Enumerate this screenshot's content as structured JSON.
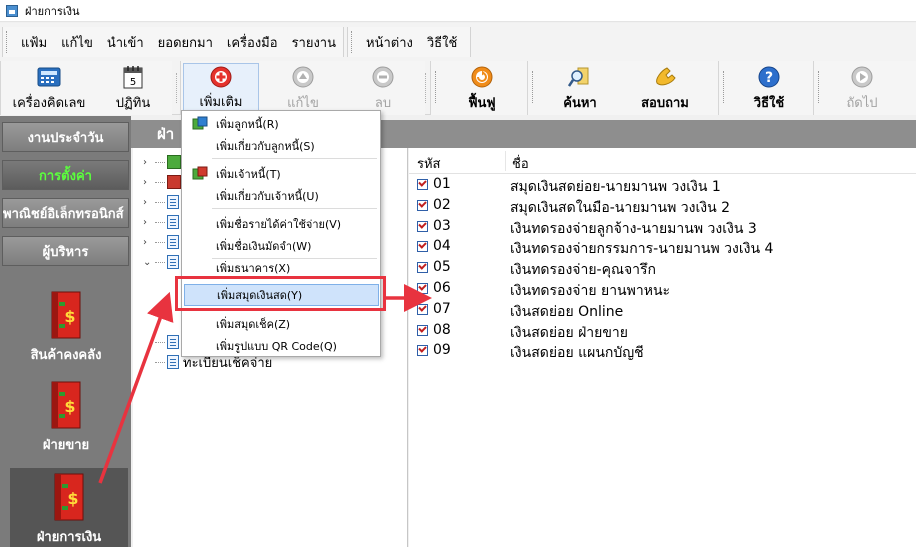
{
  "window": {
    "title": "ฝ่ายการเงิน"
  },
  "menubar": {
    "group1": [
      "แฟ้ม",
      "แก้ไข",
      "นำเข้า",
      "ยอดยกมา",
      "เครื่องมือ",
      "รายงาน"
    ],
    "group2": [
      "หน้าต่าง",
      "วิธีใช้"
    ]
  },
  "toolbar": {
    "calculator": "เครื่องคิดเลข",
    "calendar": "ปฏิทิน",
    "calendar_day": "5",
    "add": "เพิ่มเติม",
    "edit": "แก้ไข",
    "delete": "ลบ",
    "restore": "ฟื้นฟู",
    "search": "ค้นหา",
    "inquire": "สอบถาม",
    "help": "วิธีใช้",
    "next": "ถัดไป"
  },
  "sidebar": {
    "tabs": [
      "งานประจำวัน",
      "การตั้งค่า",
      "พาณิชย์อิเล็กทรอนิกส์",
      "ผู้บริหาร"
    ],
    "active_tab": "การตั้งค่า",
    "modules": [
      "สินค้าคงคลัง",
      "ฝ่ายขาย",
      "ฝ่ายการเงิน"
    ],
    "selected_module": "ฝ่ายการเงิน"
  },
  "header": {
    "title": "ฝ่า"
  },
  "tree": {
    "last_item": "ทะเบียนเช็คจ่าย"
  },
  "popup": {
    "items": [
      "เพิ่มลูกหนี้(R)",
      "เพิ่มเกี่ยวกับลูกหนี้(S)",
      "เพิ่มเจ้าหนี้(T)",
      "เพิ่มเกี่ยวกับเจ้าหนี้(U)",
      "เพิ่มชื่อรายได้ค่าใช้จ่าย(V)",
      "เพิ่มชื่อเงินมัดจำ(W)",
      "เพิ่มธนาคาร(X)",
      "เพิ่มสมุดเงินสด(Y)",
      "เพิ่มสมุดเช็ค(Z)",
      "เพิ่มรูปแบบ QR Code(Q)"
    ],
    "highlighted": "เพิ่มสมุดเงินสด(Y)"
  },
  "list": {
    "columns": [
      "รหัส",
      "ชื่อ"
    ],
    "rows": [
      {
        "code": "01",
        "name": "สมุดเงินสดย่อย-นายมานพ วงเงิน 1"
      },
      {
        "code": "02",
        "name": "สมุดเงินสดในมือ-นายมานพ วงเงิน 2"
      },
      {
        "code": "03",
        "name": "เงินทดรองจ่ายลูกจ้าง-นายมานพ วงเงิน 3"
      },
      {
        "code": "04",
        "name": "เงินทดรองจ่ายกรรมการ-นายมานพ วงเงิน 4"
      },
      {
        "code": "05",
        "name": "เงินทดรองจ่าย-คุณจารึก"
      },
      {
        "code": "06",
        "name": "เงินทดรองจ่าย ยานพาหนะ"
      },
      {
        "code": "07",
        "name": "เงินสดย่อย Online"
      },
      {
        "code": "08",
        "name": "เงินสดย่อย ฝ่ายขาย"
      },
      {
        "code": "09",
        "name": "เงินสดย่อย แผนกบัญชี"
      }
    ]
  },
  "colors": {
    "accent_red": "#e8333f",
    "active_tab_green": "#5bff3d",
    "sidebar_gray": "#7b7b7b"
  }
}
